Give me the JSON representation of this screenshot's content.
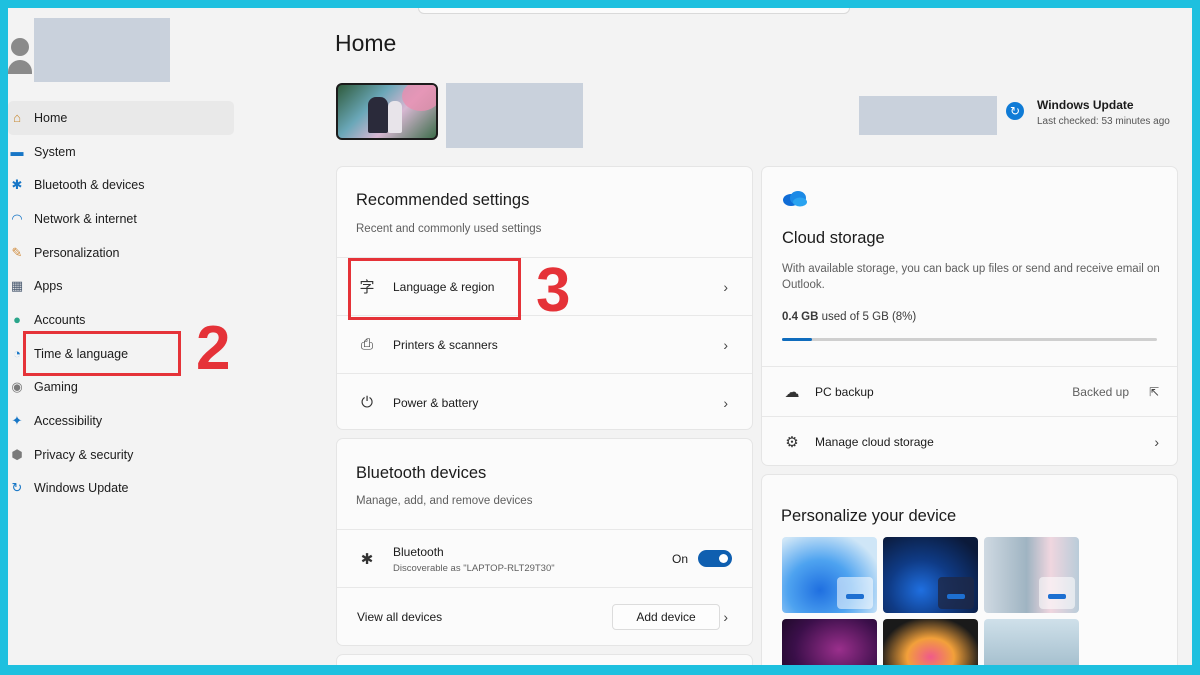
{
  "sidebar": {
    "items": [
      {
        "label": "Home",
        "icon": "home-icon",
        "glyph": "⌂",
        "color": "#c7882f"
      },
      {
        "label": "System",
        "icon": "monitor-icon",
        "glyph": "▬",
        "color": "#1776c6"
      },
      {
        "label": "Bluetooth & devices",
        "icon": "bluetooth-icon",
        "glyph": "✱",
        "color": "#1776c6"
      },
      {
        "label": "Network & internet",
        "icon": "wifi-icon",
        "glyph": "◠",
        "color": "#1776c6"
      },
      {
        "label": "Personalization",
        "icon": "brush-icon",
        "glyph": "✎",
        "color": "#d08a3a"
      },
      {
        "label": "Apps",
        "icon": "apps-icon",
        "glyph": "▦",
        "color": "#4a5a70"
      },
      {
        "label": "Accounts",
        "icon": "person-icon",
        "glyph": "●",
        "color": "#2aa58a"
      },
      {
        "label": "Time & language",
        "icon": "globe-clock-icon",
        "glyph": "◔",
        "color": "#1776c6"
      },
      {
        "label": "Gaming",
        "icon": "gamepad-icon",
        "glyph": "◉",
        "color": "#7a7a7a"
      },
      {
        "label": "Accessibility",
        "icon": "accessibility-icon",
        "glyph": "✦",
        "color": "#1776c6"
      },
      {
        "label": "Privacy & security",
        "icon": "shield-icon",
        "glyph": "⬢",
        "color": "#7a7a7a"
      },
      {
        "label": "Windows Update",
        "icon": "update-icon",
        "glyph": "↻",
        "color": "#1776c6"
      }
    ]
  },
  "annotations": {
    "step2": "2",
    "step3": "3",
    "color": "#e53238"
  },
  "main": {
    "title": "Home",
    "windows_update": {
      "title": "Windows Update",
      "subtitle": "Last checked: 53 minutes ago"
    },
    "recommended": {
      "title": "Recommended settings",
      "subtitle": "Recent and commonly used settings",
      "rows": [
        {
          "label": "Language & region"
        },
        {
          "label": "Printers & scanners"
        },
        {
          "label": "Power & battery"
        }
      ]
    },
    "bluetooth": {
      "title": "Bluetooth devices",
      "subtitle": "Manage, add, and remove devices",
      "device_name": "Bluetooth",
      "device_status": "Discoverable as \"LAPTOP-RLT29T30\"",
      "toggle_label": "On",
      "view_all": "View all devices",
      "add_device": "Add device"
    },
    "cloud": {
      "title": "Cloud storage",
      "description": "With available storage, you can back up files or send and receive email on Outlook.",
      "used": "0.4 GB",
      "used_rest": "used of 5 GB (8%)",
      "used_fraction": 0.08,
      "pc_backup": "PC backup",
      "backed_up": "Backed up",
      "manage": "Manage cloud storage"
    },
    "personalize": {
      "title": "Personalize your device"
    }
  },
  "colors": {
    "accent": "#0f6cbd",
    "annotation": "#e53238",
    "frame": "#1ec0df"
  }
}
